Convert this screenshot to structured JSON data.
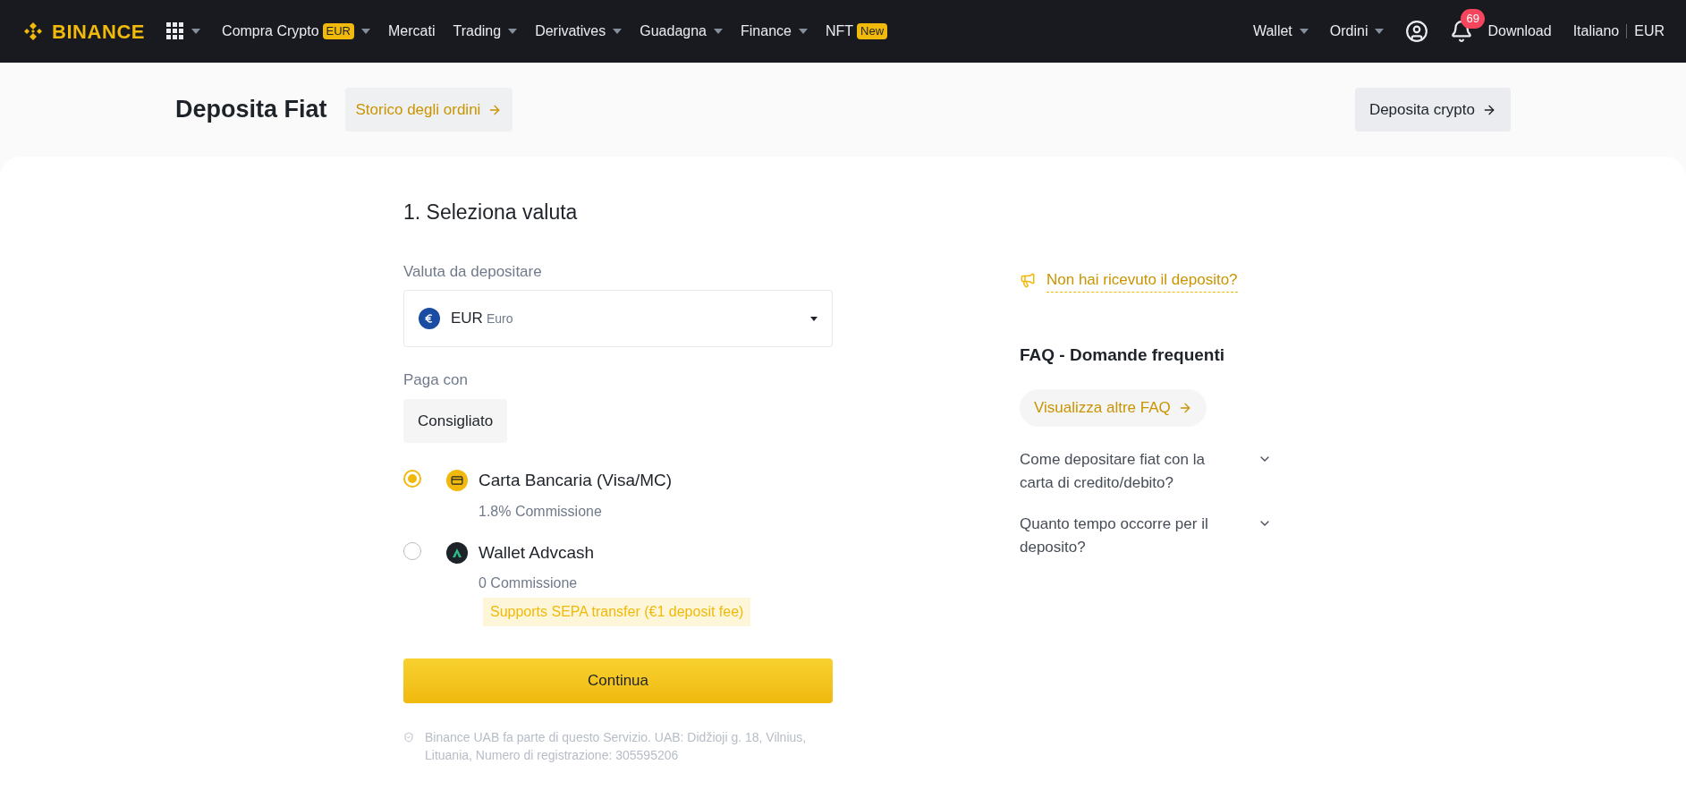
{
  "nav": {
    "logo": "BINANCE",
    "items": [
      {
        "label": "Compra Crypto",
        "badge": "EUR",
        "dropdown": true
      },
      {
        "label": "Mercati",
        "dropdown": false
      },
      {
        "label": "Trading",
        "dropdown": true
      },
      {
        "label": "Derivatives",
        "dropdown": true
      },
      {
        "label": "Guadagna",
        "dropdown": true
      },
      {
        "label": "Finance",
        "dropdown": true
      },
      {
        "label": "NFT",
        "badge": "New",
        "dropdown": false
      }
    ],
    "right_items": [
      {
        "label": "Wallet",
        "dropdown": true
      },
      {
        "label": "Ordini",
        "dropdown": true
      }
    ],
    "notifications": "69",
    "download": "Download",
    "language": "Italiano",
    "currency": "EUR"
  },
  "header": {
    "title": "Deposita Fiat",
    "history_link": "Storico degli ordini",
    "crypto_button": "Deposita crypto"
  },
  "form": {
    "step_title": "1. Seleziona valuta",
    "currency_label": "Valuta da depositare",
    "currency": {
      "code": "EUR",
      "name": "Euro"
    },
    "pay_label": "Paga con",
    "filter": "Consigliato",
    "methods": [
      {
        "kind": "card",
        "name": "Carta Bancaria (Visa/MC)",
        "fee": "1.8% Commissione",
        "selected": true
      },
      {
        "kind": "advcash",
        "name": "Wallet Advcash",
        "fee": "0 Commissione",
        "note": "Supports SEPA transfer (€1 deposit fee)",
        "selected": false
      }
    ],
    "continue": "Continua",
    "footnote": "Binance UAB fa parte di questo Servizio. UAB: Didžioji g. 18, Vilnius, Lituania, Numero di registrazione: 305595206"
  },
  "side": {
    "not_received": "Non hai ricevuto il deposito?",
    "faq_title": "FAQ - Domande frequenti",
    "faq_more": "Visualizza altre FAQ",
    "faqs": [
      {
        "question": "Come depositare fiat con la carta di credito/debito?",
        "expanded": false
      },
      {
        "question": "Quanto tempo occorre per il deposito?",
        "expanded": false
      }
    ]
  }
}
